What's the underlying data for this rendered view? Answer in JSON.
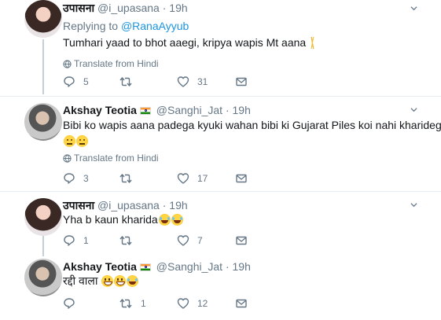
{
  "tweets": [
    {
      "name": "उपासना",
      "handle": "@i_upasana",
      "time": "19h",
      "replying_prefix": "Replying to ",
      "replying_to": "@RanaAyyub",
      "text": "Tumhari yaad to bhot aaegi, kripya wapis Mt aana",
      "translate": "Translate from Hindi",
      "replies": "5",
      "retweets": "",
      "likes": "31"
    },
    {
      "name": "Akshay Teotia",
      "handle": "@Sanghi_Jat",
      "time": "19h",
      "text_line1": "Bibi ko wapis aana padega kyuki wahan bibi ki Gujarat Piles koi nahi kharidega",
      "translate": "Translate from Hindi",
      "replies": "3",
      "retweets": "",
      "likes": "17"
    },
    {
      "name": "उपासना",
      "handle": "@i_upasana",
      "time": "19h",
      "text": "Yha b kaun kharida",
      "replies": "1",
      "retweets": "",
      "likes": "7"
    },
    {
      "name": "Akshay Teotia",
      "handle": "@Sanghi_Jat",
      "time": "19h",
      "text": "रद्दी वाला",
      "replies": "",
      "retweets": "1",
      "likes": "12"
    }
  ],
  "separator": "·",
  "colors": {
    "link": "#1b95e0",
    "muted": "#657786",
    "thread": "#c4cfd6"
  },
  "icons": [
    "chevron-down-icon",
    "reply-icon",
    "retweet-icon",
    "like-icon",
    "message-icon",
    "globe-icon",
    "pray-emoji",
    "neutral-face-emoji",
    "laughing-tears-emoji",
    "grinning-emoji",
    "india-flag-icon"
  ]
}
